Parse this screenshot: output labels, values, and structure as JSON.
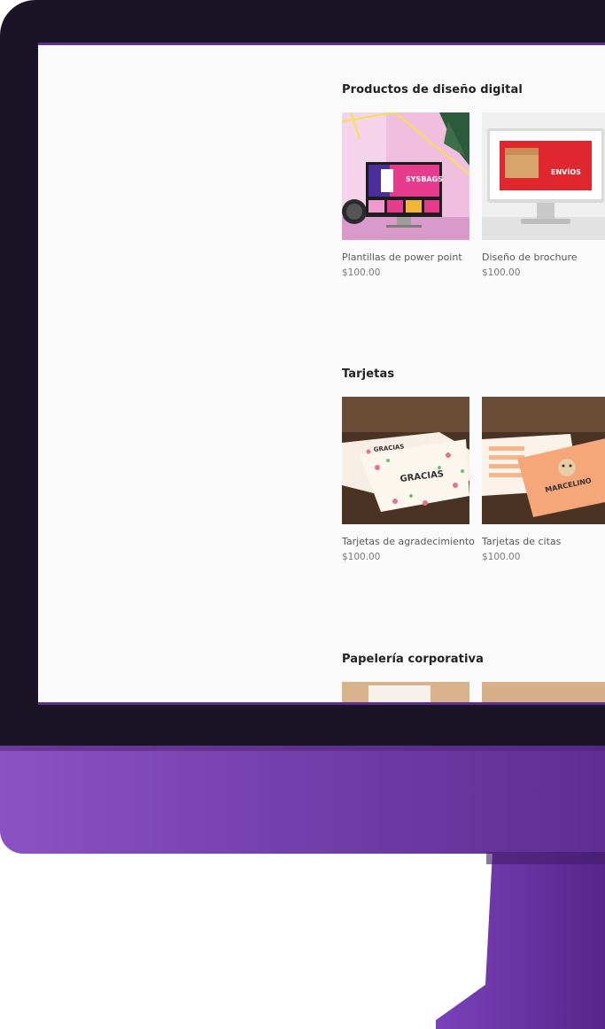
{
  "colors": {
    "accent": "#7440ad",
    "bezel": "#1b1326",
    "screen_bg": "#fafafa"
  },
  "sections": [
    {
      "title": "Productos de diseño digital",
      "products": [
        {
          "name": "Plantillas de power point",
          "price": "$100.00",
          "mock_text": "SYSBAGS"
        },
        {
          "name": "Diseño de brochure",
          "price": "$100.00",
          "mock_text": "ENVÍOS"
        }
      ]
    },
    {
      "title": "Tarjetas",
      "products": [
        {
          "name": "Tarjetas de agradecimiento",
          "price": "$100.00",
          "mock_text": "GRACIAS"
        },
        {
          "name": "Tarjetas de citas",
          "price": "$100.00",
          "mock_text": "MARCELINO"
        }
      ]
    },
    {
      "title": "Papelería corporativa",
      "products": []
    }
  ]
}
